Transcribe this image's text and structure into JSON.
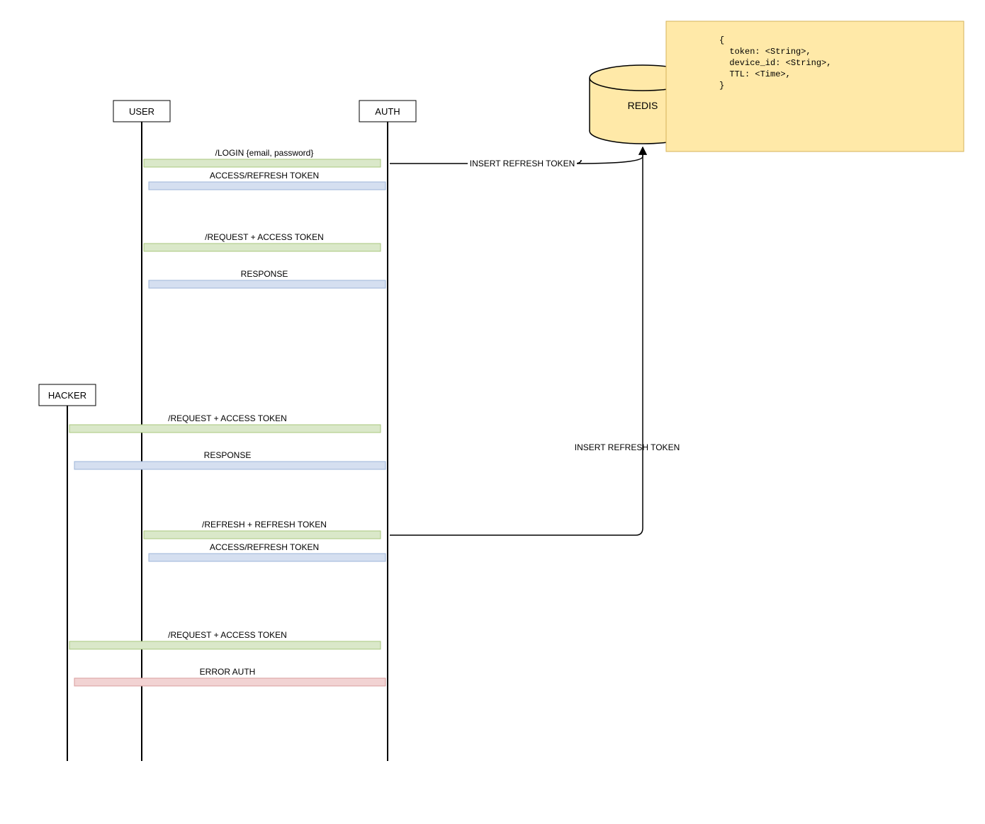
{
  "actors": {
    "user": "USER",
    "auth": "AUTH",
    "hacker": "HACKER",
    "redis": "REDIS"
  },
  "messages": {
    "login": "/LOGIN {email, password}",
    "access_refresh_token": "ACCESS/REFRESH TOKEN",
    "request_access": "/REQUEST + ACCESS TOKEN",
    "response": "RESPONSE",
    "refresh": "/REFRESH + REFRESH TOKEN",
    "error_auth": "ERROR AUTH",
    "insert_refresh1": "INSERT REFRESH TOKEN",
    "insert_refresh2": "INSERT REFRESH TOKEN"
  },
  "note": {
    "line1": "{",
    "line2": "  token: <String>,",
    "line3": "  device_id: <String>,",
    "line4": "  TTL: <Time>,",
    "line5": "}"
  },
  "colors": {
    "green_fill": "#dae8c9",
    "green_stroke": "#a9c77d",
    "blue_fill": "#d5dff0",
    "blue_stroke": "#9db5d8",
    "red_fill": "#f2d3d3",
    "red_stroke": "#d89c9c",
    "yellow_fill": "#ffe9a8",
    "yellow_stroke": "#d4b35a"
  }
}
